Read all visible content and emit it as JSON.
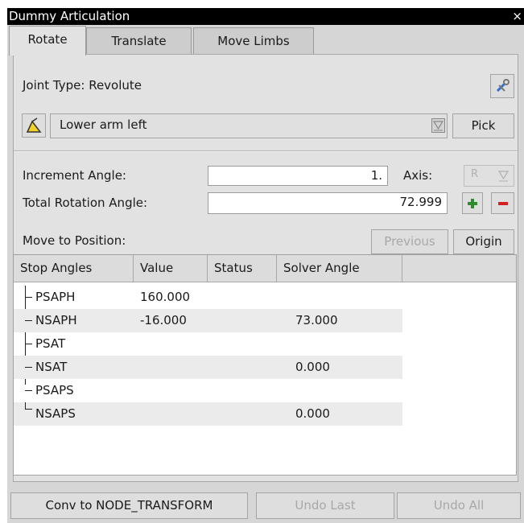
{
  "window": {
    "title": "Dummy Articulation",
    "close_glyph": "×"
  },
  "tabs": [
    {
      "label": "Rotate",
      "active": true
    },
    {
      "label": "Translate",
      "active": false
    },
    {
      "label": "Move Limbs",
      "active": false
    }
  ],
  "joint": {
    "label": "Joint Type: Revolute"
  },
  "limb": {
    "selected": "Lower arm left",
    "pick_label": "Pick"
  },
  "increment": {
    "label": "Increment Angle:",
    "value": "1."
  },
  "axis": {
    "label": "Axis:",
    "selected": "R"
  },
  "total": {
    "label": "Total Rotation Angle:",
    "value": "72.999"
  },
  "move": {
    "label": "Move to Position:",
    "previous_label": "Previous",
    "origin_label": "Origin"
  },
  "table": {
    "columns": [
      "Stop Angles",
      "Value",
      "Status",
      "Solver Angle"
    ],
    "rows": [
      {
        "name": "PSAPH",
        "value": "160.000",
        "status": "",
        "solver": ""
      },
      {
        "name": "NSAPH",
        "value": "-16.000",
        "status": "",
        "solver": "73.000"
      },
      {
        "name": "PSAT",
        "value": "",
        "status": "",
        "solver": ""
      },
      {
        "name": "NSAT",
        "value": "",
        "status": "",
        "solver": "0.000"
      },
      {
        "name": "PSAPS",
        "value": "",
        "status": "",
        "solver": ""
      },
      {
        "name": "NSAPS",
        "value": "",
        "status": "",
        "solver": "0.000"
      }
    ]
  },
  "footer": {
    "conv_label": "Conv to NODE_TRANSFORM",
    "undo_last_label": "Undo Last",
    "undo_all_label": "Undo All"
  },
  "colors": {
    "plus": "#2e8b2e",
    "minus": "#d42020",
    "pencil": "#f2d22a"
  }
}
